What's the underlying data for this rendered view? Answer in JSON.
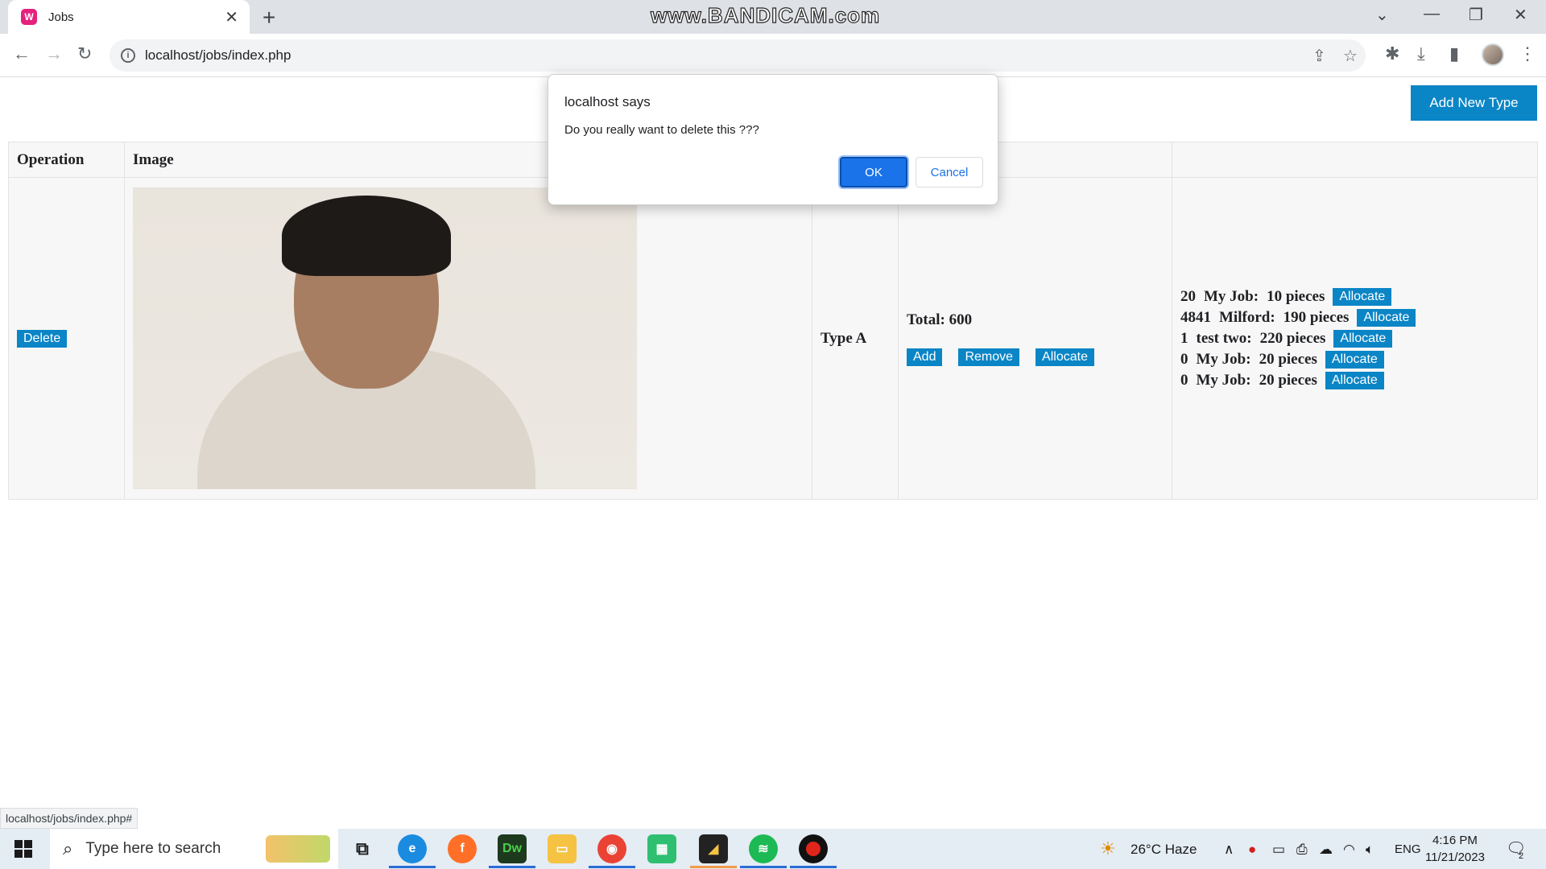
{
  "browser": {
    "tab_title": "Jobs",
    "tab_favicon": "W",
    "url": "localhost/jobs/index.php",
    "watermark": "www.BANDICAM.com",
    "status_link": "localhost/jobs/index.php#"
  },
  "page": {
    "add_new_type_label": "Add New Type",
    "table": {
      "headers": [
        "Operation",
        "Image",
        "",
        "",
        "",
        ""
      ],
      "row": {
        "delete_label": "Delete",
        "type": "Type A",
        "total": "Total: 600",
        "add_label": "Add",
        "remove_label": "Remove",
        "allocate_label": "Allocate",
        "allocations": [
          {
            "qty": "20",
            "job": "My Job:",
            "pieces": "10 pieces",
            "button": "Allocate"
          },
          {
            "qty": "4841",
            "job": "Milford:",
            "pieces": "190 pieces",
            "button": "Allocate"
          },
          {
            "qty": "1",
            "job": "test two:",
            "pieces": "220 pieces",
            "button": "Allocate"
          },
          {
            "qty": "0",
            "job": "My Job:",
            "pieces": "20 pieces",
            "button": "Allocate"
          },
          {
            "qty": "0",
            "job": "My Job:",
            "pieces": "20 pieces",
            "button": "Allocate"
          }
        ]
      }
    }
  },
  "dialog": {
    "title": "localhost says",
    "message": "Do you really want to delete this ???",
    "ok_label": "OK",
    "cancel_label": "Cancel"
  },
  "taskbar": {
    "search_placeholder": "Type here to search",
    "weather": "26°C  Haze",
    "language": "ENG",
    "time": "4:16 PM",
    "date": "11/21/2023",
    "notifications": "2"
  }
}
